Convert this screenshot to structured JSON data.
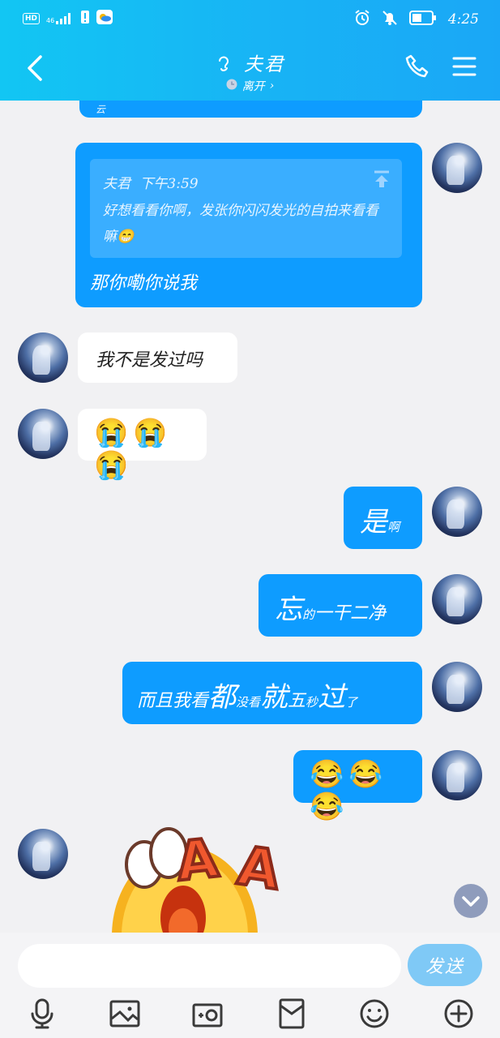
{
  "status_bar": {
    "hd_badge": "HD",
    "network": "46",
    "time": "4:25"
  },
  "header": {
    "contact_name": "夫君",
    "status": "离开",
    "status_chevron": "›"
  },
  "messages": [
    {
      "id": "m0",
      "direction": "out",
      "text": "云"
    },
    {
      "id": "m1",
      "direction": "out",
      "quote": {
        "sender": "夫君",
        "time": "下午3:59",
        "text": "好想看看你啊，发张你闪闪发光的自拍来看看嘛😁"
      },
      "text": "那你嘞你说我"
    },
    {
      "id": "m2",
      "direction": "in",
      "text": "我不是发过吗"
    },
    {
      "id": "m3",
      "direction": "in",
      "text": "😭😭😭"
    },
    {
      "id": "m4",
      "direction": "out",
      "parts": [
        "是",
        "啊"
      ]
    },
    {
      "id": "m5",
      "direction": "out",
      "parts": [
        "忘",
        "的",
        "一干二净"
      ]
    },
    {
      "id": "m6",
      "direction": "out",
      "parts": [
        "而且我看",
        "都",
        "没看",
        "就",
        "五",
        "秒",
        "过",
        "了"
      ]
    },
    {
      "id": "m7",
      "direction": "out",
      "text": "😂😂😂"
    },
    {
      "id": "m8",
      "direction": "in",
      "sticker_text": [
        "A",
        "A"
      ]
    }
  ],
  "input": {
    "value": "",
    "placeholder": ""
  },
  "send_button": "发送",
  "toolbar": [
    "microphone-icon",
    "image-icon",
    "camera-icon",
    "red-packet-icon",
    "emoji-icon",
    "plus-icon"
  ],
  "colors": {
    "header_start": "#12c6f3",
    "header_end": "#1aa7f6",
    "bubble_out": "#0e9cff",
    "bubble_in": "#ffffff",
    "quote_bg": "#3aaeff",
    "send_button": "#7fc9f6",
    "background": "#f1f1f3"
  }
}
